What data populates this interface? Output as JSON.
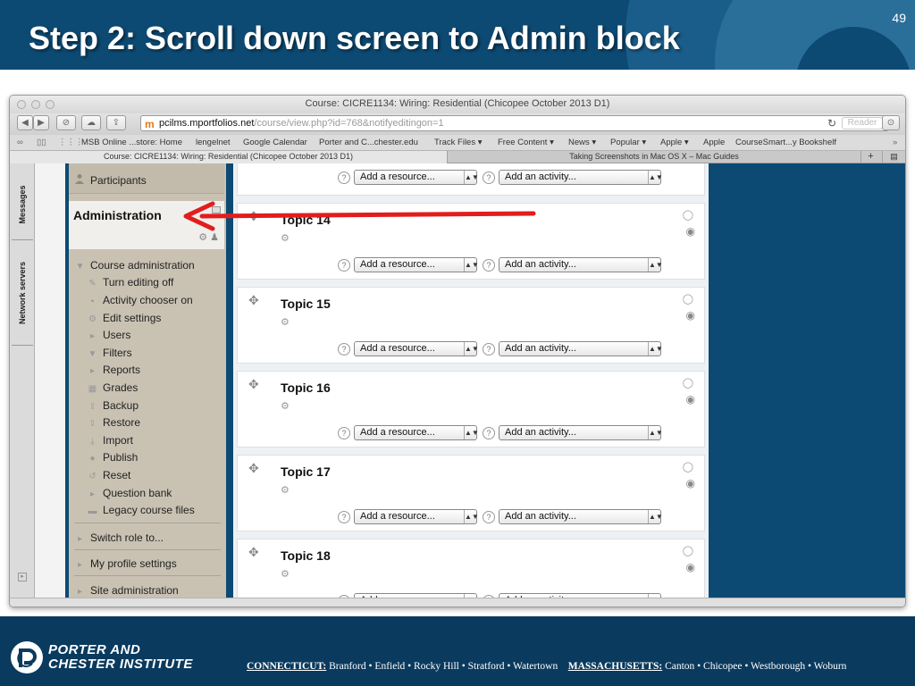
{
  "slide": {
    "title": "Step 2: Scroll down screen to Admin block",
    "number": "49"
  },
  "browser": {
    "window_title": "Course: CICRE1134: Wiring: Residential (Chicopee October 2013 D1)",
    "url_domain": "pcilms.mportfolios.net",
    "url_path": "/course/view.php?id=768&notifyeditingon=1",
    "reader_label": "Reader",
    "bookmarks": [
      "MSB Online ...store: Home",
      "lengelnet",
      "Google Calendar",
      "Porter and C...chester.edu",
      "Track Files ▾",
      "Free Content ▾",
      "News ▾",
      "Popular ▾",
      "Apple ▾",
      "Apple",
      "CourseSmart...y Bookshelf"
    ],
    "tabs": [
      "Course: CICRE1134: Wiring: Residential (Chicopee October 2013 D1)",
      "Taking Screenshots in Mac OS X – Mac Guides"
    ]
  },
  "drawer": {
    "tabs": [
      "Messages",
      "Network servers"
    ]
  },
  "sidebar": {
    "participants": "Participants",
    "admin_title": "Administration",
    "course_admin": "Course administration",
    "items": [
      "Turn editing off",
      "Activity chooser on",
      "Edit settings",
      "Users",
      "Filters",
      "Reports",
      "Grades",
      "Backup",
      "Restore",
      "Import",
      "Publish",
      "Reset",
      "Question bank",
      "Legacy course files"
    ],
    "switch_role": "Switch role to...",
    "profile_settings": "My profile settings",
    "site_admin": "Site administration"
  },
  "main": {
    "add_resource": "Add a resource...",
    "add_activity": "Add an activity...",
    "topics": [
      "Topic 14",
      "Topic 15",
      "Topic 16",
      "Topic 17",
      "Topic 18"
    ]
  },
  "footer": {
    "logo_line1": "PORTER AND",
    "logo_line2": "CHESTER INSTITUTE",
    "ct_label": "CONNECTICUT:",
    "ct_cities": "Branford • Enfield • Rocky Hill • Stratford • Watertown",
    "ma_label": "MASSACHUSETTS:",
    "ma_cities": "Canton • Chicopee • Westborough • Woburn"
  },
  "colors": {
    "slide_blue": "#0d4a73",
    "arrow_red": "#e21d1d"
  }
}
